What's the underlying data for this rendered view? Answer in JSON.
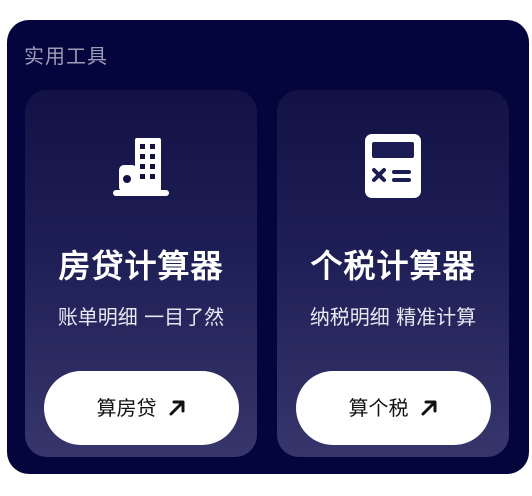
{
  "section": {
    "title": "实用工具"
  },
  "cards": [
    {
      "icon": "building-icon",
      "title": "房贷计算器",
      "subtitle": "账单明细 一目了然",
      "button_label": "算房贷"
    },
    {
      "icon": "calculator-icon",
      "title": "个税计算器",
      "subtitle": "纳税明细 精准计算",
      "button_label": "算个税"
    }
  ],
  "colors": {
    "panel_background": "#05053d",
    "card_gradient_top": "#121246",
    "card_gradient_bottom": "#36366c",
    "button_background": "#ffffff",
    "accent_text": "#ffffff"
  },
  "icons": {
    "arrow": "arrow-up-right-icon"
  }
}
